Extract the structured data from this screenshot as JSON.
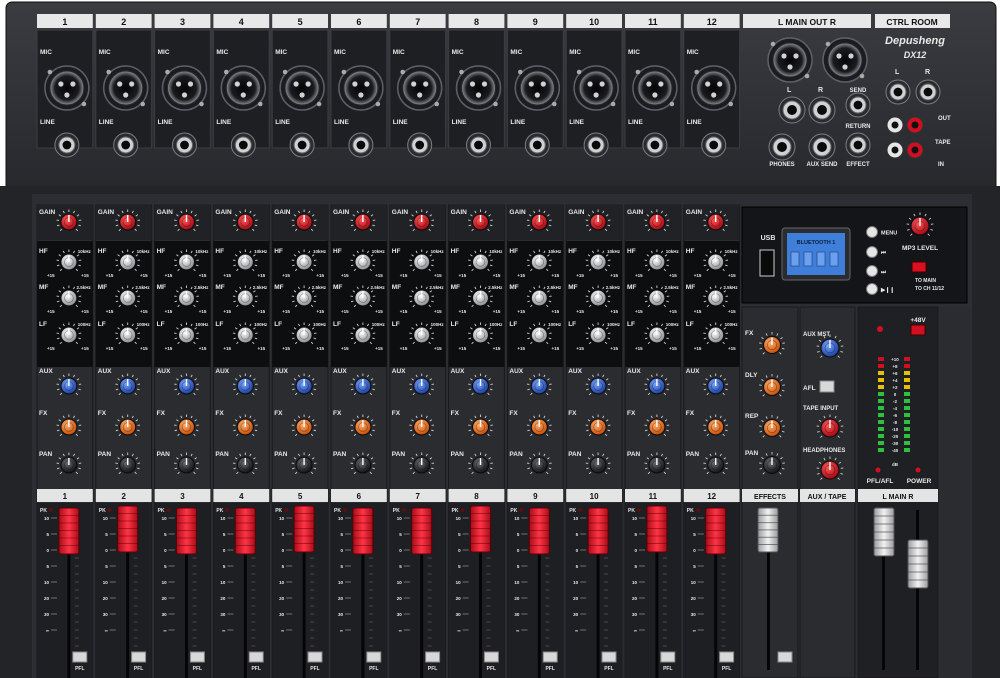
{
  "brand": {
    "name": "Depusheng",
    "model": "DX12"
  },
  "top_headers": {
    "main_out": "L  MAIN OUT  R",
    "ctrl_room": "CTRL ROOM"
  },
  "jack_labels": {
    "mic": "MIC",
    "line": "LINE"
  },
  "channel_numbers": [
    "1",
    "2",
    "3",
    "4",
    "5",
    "6",
    "7",
    "8",
    "9",
    "10",
    "11",
    "12"
  ],
  "right_io": {
    "l": "L",
    "r": "R",
    "phones": "PHONES",
    "aux_send": "AUX SEND",
    "send": "SEND",
    "return": "RETURN",
    "effect": "EFFECT",
    "out": "OUT",
    "tape": "TAPE",
    "in": "IN"
  },
  "strip_labels": {
    "gain": "GAIN",
    "hf": "HF",
    "mf": "MF",
    "lf": "LF",
    "aux": "AUX",
    "fx": "FX",
    "pan": "PAN",
    "pfl": "PFL",
    "db": "dB",
    "pk": "PK"
  },
  "eq_freqs": {
    "hf": "10kHz",
    "mf": "2.5kHz",
    "lf": "100Hz",
    "range": "+15"
  },
  "mp3": {
    "usb": "USB",
    "display_text": "BLUETOOTH  1",
    "menu": "MENU",
    "next": "⏭",
    "prev": "⏮",
    "play": "▶❙❙",
    "mp3_level": "MP3 LEVEL",
    "to_main": "TO MAIN",
    "to_ch": "TO CH 11/12"
  },
  "effects_section": {
    "fx": "FX",
    "dly": "DLY",
    "rep": "REP",
    "pan": "PAN",
    "label": "EFFECTS"
  },
  "aux_tape_section": {
    "aux_mst": "AUX MST",
    "afl": "AFL",
    "tape_input": "TAPE INPUT",
    "headphones": "HEADPHONES",
    "label": "AUX / TAPE"
  },
  "main_section": {
    "plus48": "+48V",
    "pfl_afl": "PFL/AFL",
    "power": "POWER",
    "label": "L  MAIN  R"
  },
  "meter_scale": [
    "+10",
    "+8",
    "+6",
    "+4",
    "+2",
    "0",
    "-2",
    "-4",
    "-6",
    "-8",
    "-10",
    "-20",
    "-30",
    "-40",
    "dB"
  ],
  "fader_scale": [
    "10",
    "5",
    "0",
    "5",
    "10",
    "20",
    "30",
    "∞"
  ],
  "colors": {
    "body": "#2c2e32",
    "panel": "#1e2024",
    "gain_knob": "#d8101f",
    "aux_knob": "#2a5fd6",
    "fx_knob": "#f06a12",
    "fader_cap": "#e0192a",
    "lcd": "#3f7fd9"
  }
}
